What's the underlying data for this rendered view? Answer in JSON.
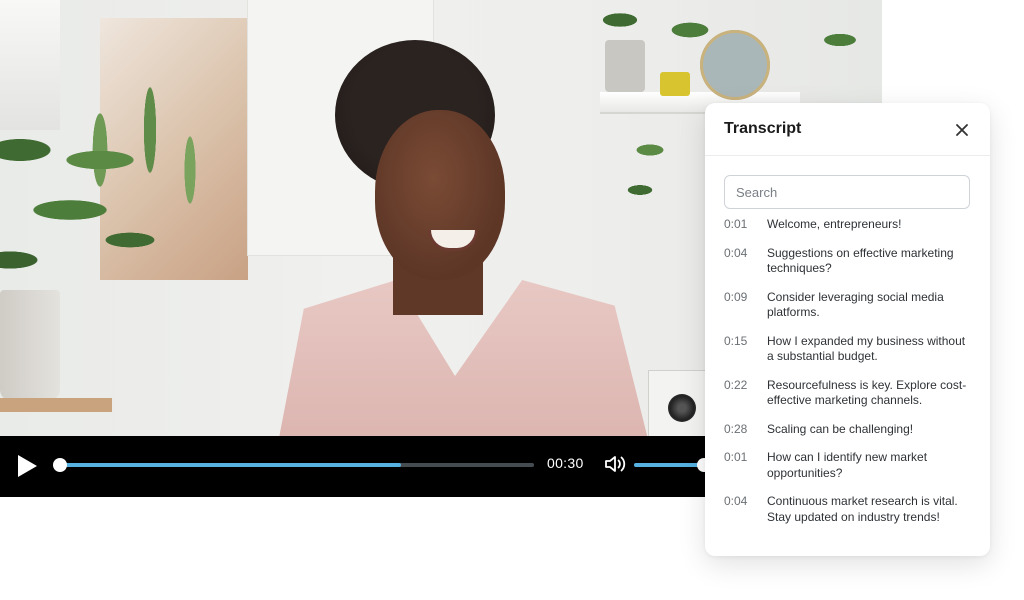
{
  "player": {
    "time_display": "00:30",
    "progress_percent": 72,
    "buffered_percent": 30,
    "volume_percent": 100,
    "accent_color": "#56b1e0",
    "play_icon": "play-icon",
    "volume_icon": "volume-icon"
  },
  "transcript": {
    "title": "Transcript",
    "close_icon": "close-icon",
    "search_placeholder": "Search",
    "search_value": "",
    "lines": [
      {
        "time": "0:01",
        "text": "Welcome, entrepreneurs!"
      },
      {
        "time": "0:04",
        "text": "Suggestions on effective marketing techniques?"
      },
      {
        "time": "0:09",
        "text": "Consider leveraging social media platforms."
      },
      {
        "time": "0:15",
        "text": "How I expanded my business without a substantial budget."
      },
      {
        "time": "0:22",
        "text": "Resourcefulness is key. Explore cost-effective marketing channels."
      },
      {
        "time": "0:28",
        "text": "Scaling can be challenging!"
      },
      {
        "time": "0:01",
        "text": "How can I identify new market opportunities?"
      },
      {
        "time": "0:04",
        "text": "Continuous market research is vital. Stay updated on industry trends!"
      }
    ]
  }
}
